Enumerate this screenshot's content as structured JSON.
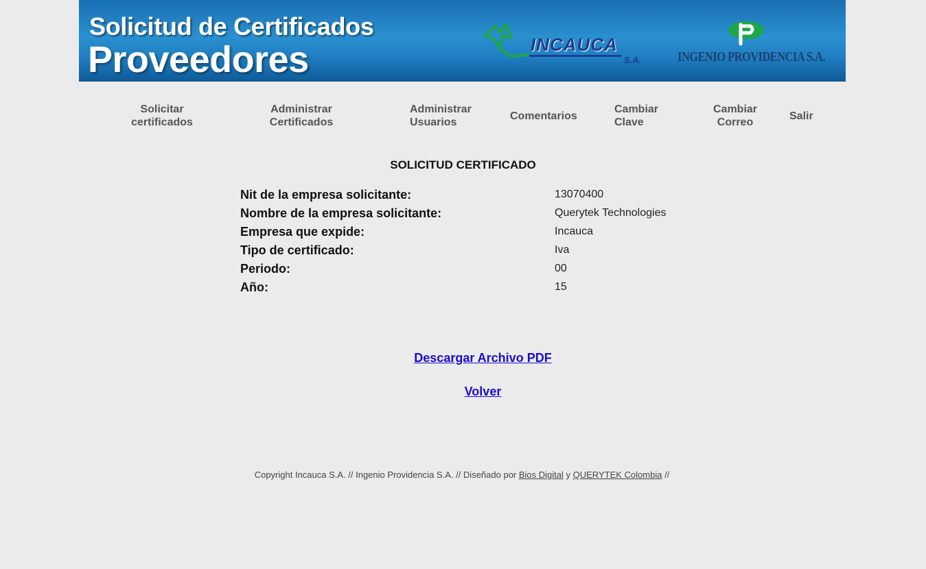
{
  "header": {
    "title_line1": "Solicitud de Certificados",
    "title_line2": "Proveedores",
    "logo_incauca_text": "INCAUCA",
    "logo_incauca_sa": "S.A.",
    "logo_providencia_text": "INGENIO PROVIDENCIA S.A."
  },
  "nav": {
    "items": [
      {
        "label": "Solicitar\ncertificados"
      },
      {
        "label": "Administrar\nCertificados"
      },
      {
        "label": "Administrar\nUsuarios"
      },
      {
        "label": "Comentarios"
      },
      {
        "label": "Cambiar\nClave"
      },
      {
        "label": "Cambiar\nCorreo"
      },
      {
        "label": "Salir"
      }
    ]
  },
  "main": {
    "heading": "SOLICITUD CERTIFICADO",
    "fields": [
      {
        "label": "Nit de la empresa solicitante:",
        "value": "13070400"
      },
      {
        "label": "Nombre de la empresa solicitante:",
        "value": "Querytek Technologies"
      },
      {
        "label": "Empresa que expide:",
        "value": "Incauca"
      },
      {
        "label": "Tipo de certificado:",
        "value": "Iva"
      },
      {
        "label": "Periodo:",
        "value": "00"
      },
      {
        "label": "Año:",
        "value": "15"
      }
    ],
    "download_link": "Descargar Archivo PDF",
    "back_link": "Volver"
  },
  "footer": {
    "text_prefix": "Copyright Incauca S.A. // Ingenio Providencia S.A. // Diseñado por ",
    "link1": "Bios Digital",
    "text_mid": " y ",
    "link2": "QUERYTEK Colombia",
    "text_suffix": " //"
  },
  "colors": {
    "background": "#ebebeb",
    "banner_blue": "#2a90cf",
    "link_blue": "#1a0dcc",
    "nav_text": "#555555",
    "logo_green": "#1ea64a"
  }
}
